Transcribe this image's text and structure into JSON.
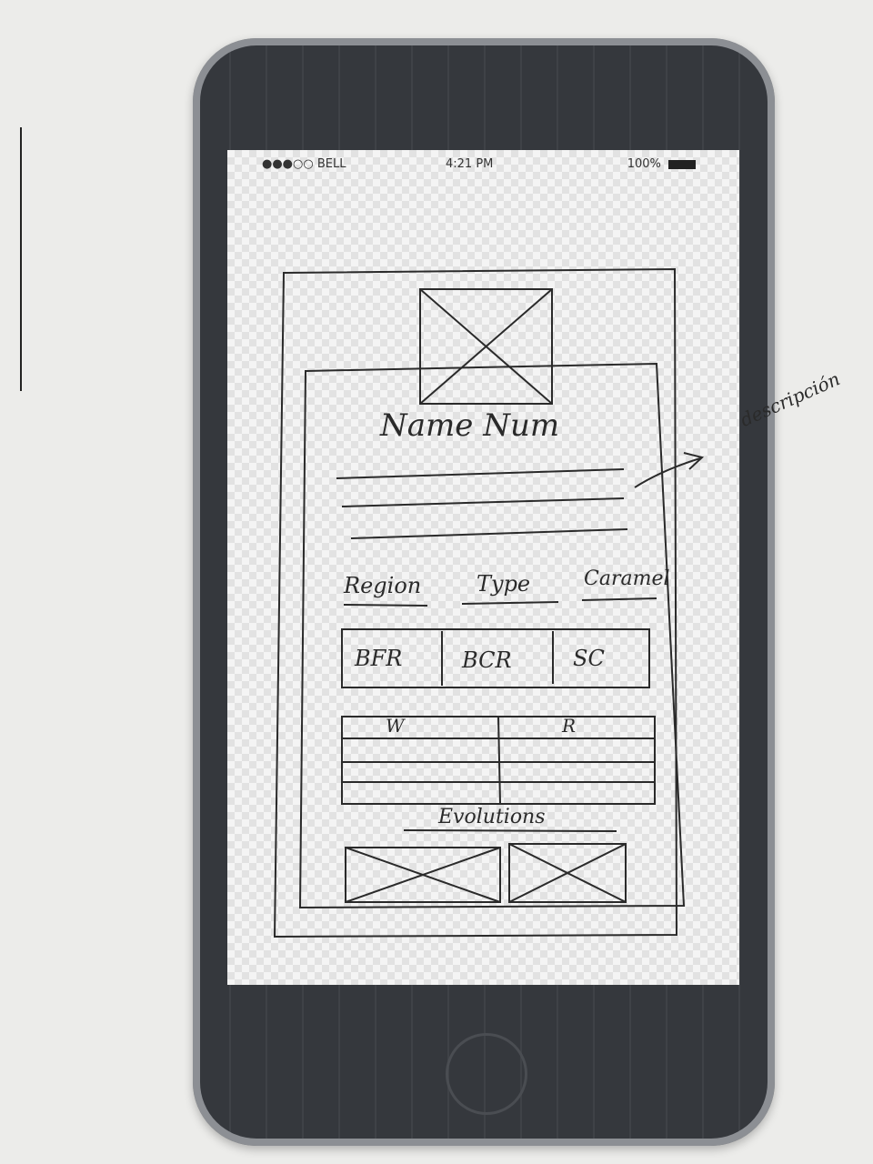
{
  "status_bar": {
    "carrier": "●●●○○ BELL",
    "time": "4:21 PM",
    "battery": "100%"
  },
  "card": {
    "title": "Name Num",
    "fields": {
      "region": "Region",
      "type": "Type",
      "third": "Caramel"
    },
    "stats": [
      "BFR",
      "BCR",
      "SC"
    ],
    "table_headers": [
      "W",
      "R"
    ],
    "evolutions_label": "Evolutions"
  },
  "annotation": "descripción",
  "icons": [
    "image-placeholder-icon",
    "wifi-icon",
    "battery-icon",
    "arrow-icon"
  ]
}
